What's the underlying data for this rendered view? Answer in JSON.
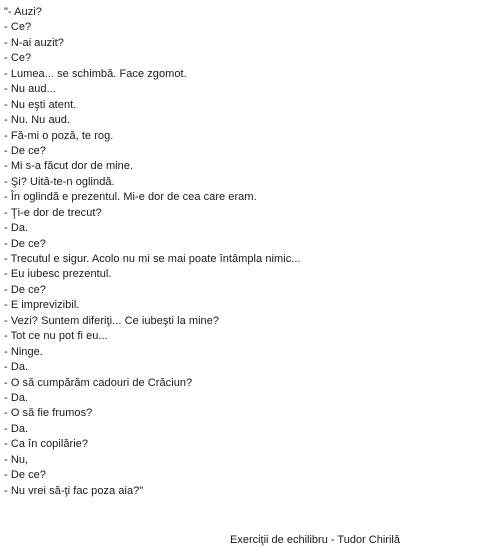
{
  "dialogue": [
    "\"- Auzi?",
    "- Ce?",
    "- N-ai auzit?",
    "- Ce?",
    "- Lumea... se schimbă. Face zgomot.",
    "- Nu aud...",
    "- Nu eşti atent.",
    "- Nu. Nu aud.",
    "- Fă-mi o poză, te rog.",
    "- De ce?",
    "- Mi s-a făcut dor de mine.",
    "- Şi? Uită-te-n oglindă.",
    "- În oglindă e prezentul. Mi-e dor de cea care eram.",
    "- Ţi-e dor de trecut?",
    "- Da.",
    "- De ce?",
    "- Trecutul e sigur. Acolo nu mi se mai poate întâmpla nimic...",
    "- Eu iubesc prezentul.",
    "- De ce?",
    "- E imprevizibil.",
    "- Vezi? Suntem diferiţi... Ce iubeşti la mine?",
    "- Tot ce nu pot fi eu...",
    "- Ninge.",
    "- Da.",
    "- O să cumpărăm cadouri de Crăciun?",
    "- Da.",
    "- O să fie frumos?",
    "- Da.",
    "- Ca în copilărie?",
    "- Nu,",
    "- De ce?",
    "- Nu vrei să-ţi fac poza aia?\""
  ],
  "attribution": "Exerciţii de echilibru - Tudor Chirilă"
}
